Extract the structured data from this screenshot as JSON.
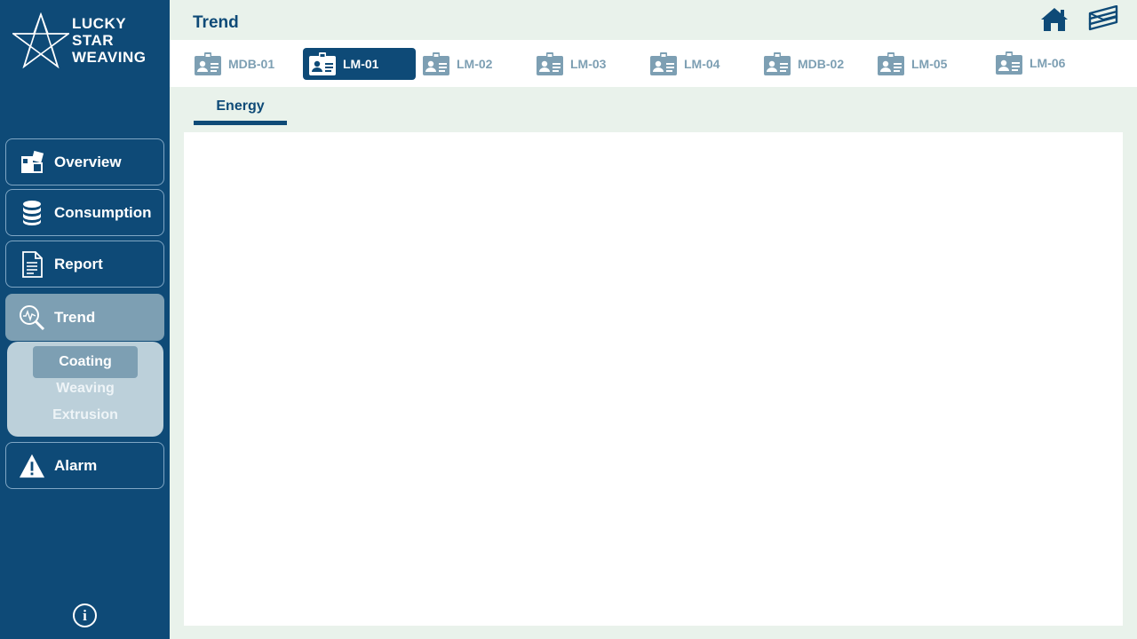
{
  "brand": {
    "line1": "LUCKY",
    "line2": "STAR",
    "line3": "WEAVING"
  },
  "header": {
    "title": "Trend"
  },
  "nav": {
    "overview": "Overview",
    "consumption": "Consumption",
    "report": "Report",
    "trend": "Trend",
    "alarm": "Alarm",
    "trend_sub": [
      "Coating",
      "Weaving",
      "Extrusion"
    ],
    "info": "i"
  },
  "devices": [
    "MDB-01",
    "LM-01",
    "LM-02",
    "LM-03",
    "LM-04",
    "MDB-02",
    "LM-05",
    "LM-06"
  ],
  "active_device": "LM-01",
  "subtab": {
    "label": "Energy"
  },
  "colors": {
    "primary": "#0e4a77",
    "muted": "#7d9fb3",
    "background": "#e9f2eb",
    "submenu": "#bcd0da"
  }
}
